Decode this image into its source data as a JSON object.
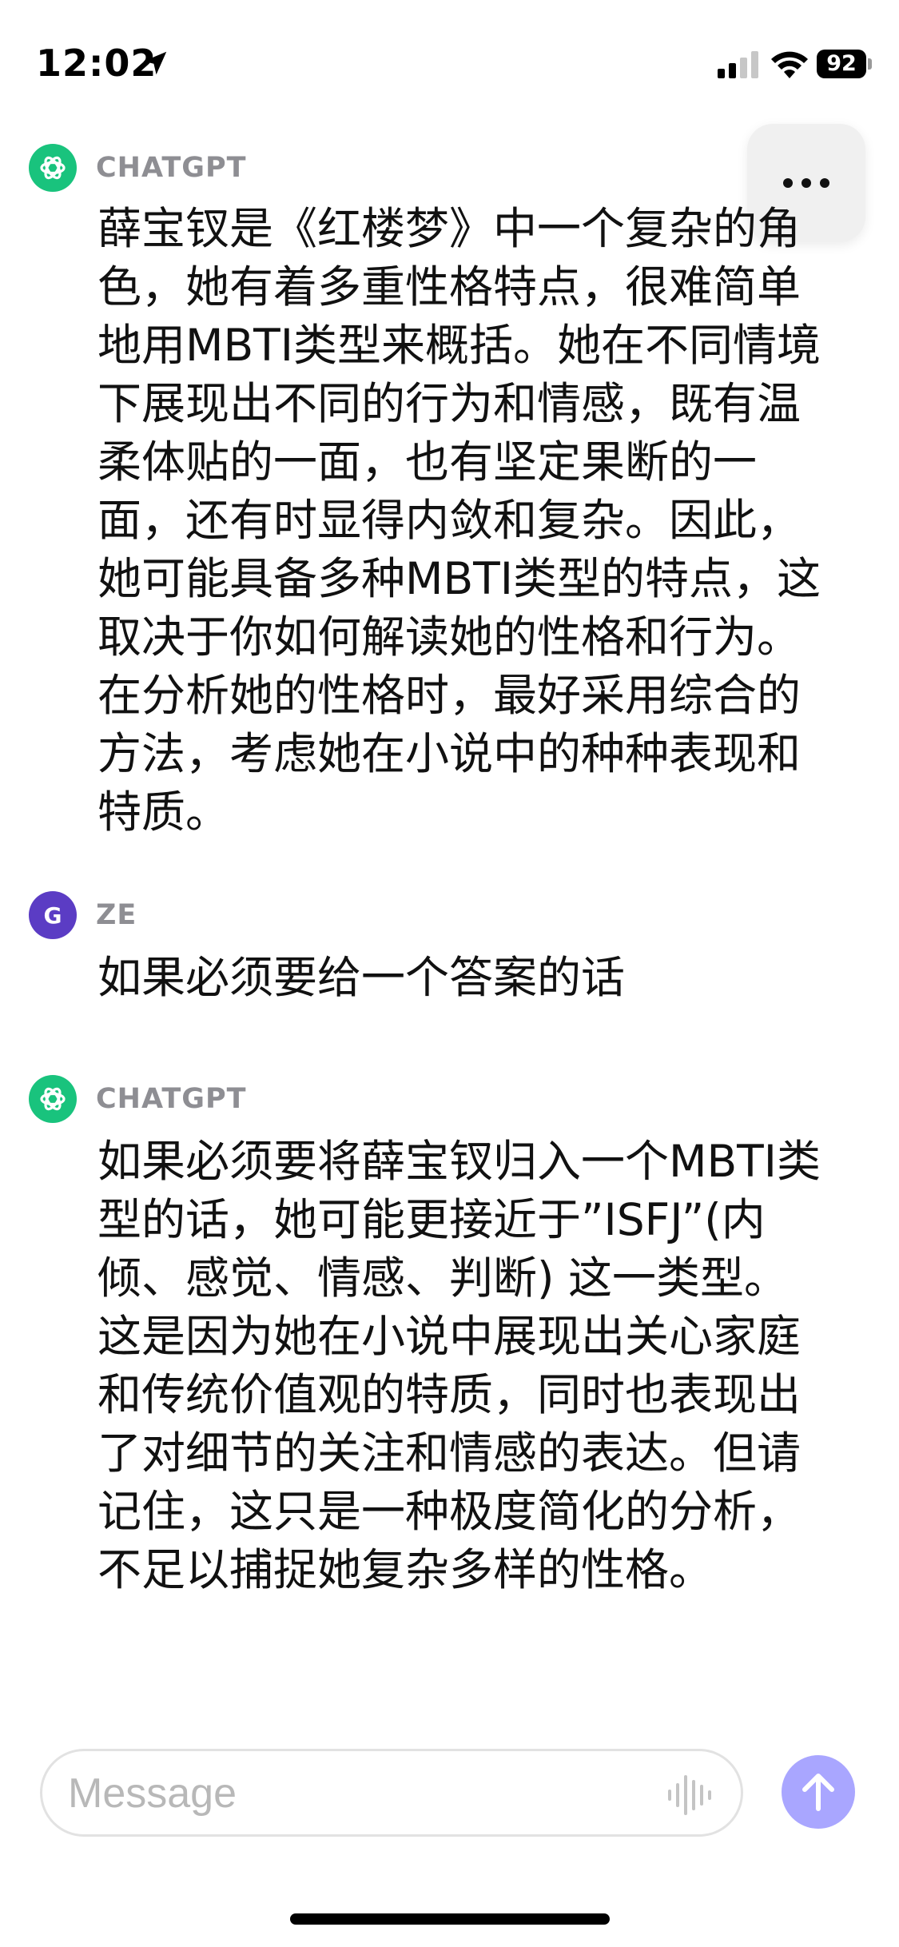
{
  "status_bar": {
    "time": "12:02",
    "battery": "92"
  },
  "conversation": [
    {
      "sender": "CHATGPT",
      "text": "薛宝钗是《红楼梦》中一个复杂的角色，她有着多重性格特点，很难简单地用MBTI类型来概括。她在不同情境下展现出不同的行为和情感，既有温柔体贴的一面，也有坚定果断的一面，还有时显得内敛和复杂。因此，她可能具备多种MBTI类型的特点，这取决于你如何解读她的性格和行为。在分析她的性格时，最好采用综合的方法，考虑她在小说中的种种表现和特质。"
    },
    {
      "sender": "ZE",
      "avatar_letter": "G",
      "text": "如果必须要给一个答案的话"
    },
    {
      "sender": "CHATGPT",
      "text": "如果必须要将薛宝钗归入一个MBTI类型的话，她可能更接近于”ISFJ”(内倾、感觉、情感、判断) 这一类型。这是因为她在小说中展现出关心家庭和传统价值观的特质，同时也表现出了对细节的关注和情感的表达。但请记住，这只是一种极度简化的分析，不足以捕捉她复杂多样的性格。"
    }
  ],
  "composer": {
    "placeholder": "Message",
    "value": ""
  },
  "icons": {
    "location": "location-arrow-icon",
    "signal": "cellular-signal-icon",
    "wifi": "wifi-icon",
    "more": "more-horizontal-icon",
    "openai": "openai-logo-icon",
    "voice": "voice-waveform-icon",
    "send": "arrow-up-icon"
  },
  "colors": {
    "gpt_avatar": "#19c37d",
    "user_avatar": "#5b3cc4",
    "send_button": "#a9a6ff",
    "sender_label": "#8e8e93"
  }
}
